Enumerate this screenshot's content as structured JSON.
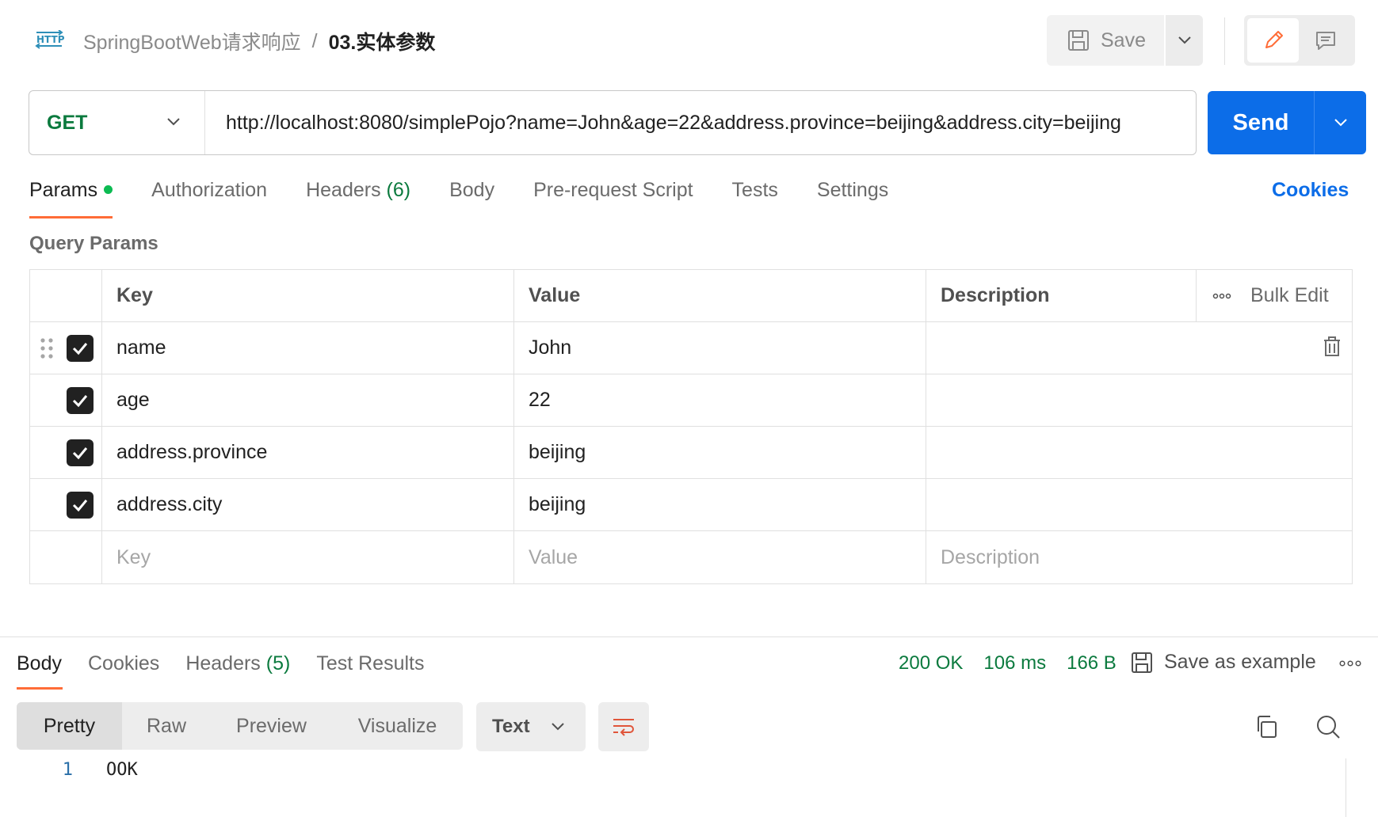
{
  "breadcrumb": {
    "collection": "SpringBootWeb请求响应",
    "separator": "/",
    "request": "03.实体参数"
  },
  "toolbar": {
    "save_label": "Save"
  },
  "request": {
    "method": "GET",
    "url": "http://localhost:8080/simplePojo?name=John&age=22&address.province=beijing&address.city=beijing",
    "send_label": "Send"
  },
  "tabs": {
    "params": "Params",
    "authorization": "Authorization",
    "headers": "Headers",
    "headers_count": "(6)",
    "body": "Body",
    "prerequest": "Pre-request Script",
    "tests": "Tests",
    "settings": "Settings",
    "cookies": "Cookies"
  },
  "query_params": {
    "title": "Query Params",
    "columns": {
      "key": "Key",
      "value": "Value",
      "description": "Description",
      "bulk_edit": "Bulk Edit"
    },
    "rows": [
      {
        "key": "name",
        "value": "John",
        "checked": true
      },
      {
        "key": "age",
        "value": "22",
        "checked": true
      },
      {
        "key": "address.province",
        "value": "beijing",
        "checked": true
      },
      {
        "key": "address.city",
        "value": "beijing",
        "checked": true
      }
    ],
    "placeholder": {
      "key": "Key",
      "value": "Value",
      "description": "Description"
    }
  },
  "response": {
    "tabs": {
      "body": "Body",
      "cookies": "Cookies",
      "headers": "Headers",
      "headers_count": "(5)",
      "test_results": "Test Results"
    },
    "status": "200 OK",
    "time": "106 ms",
    "size": "166 B",
    "save_example": "Save as example",
    "views": [
      "Pretty",
      "Raw",
      "Preview",
      "Visualize"
    ],
    "format": "Text",
    "lines": [
      {
        "no": "1",
        "text": "OOK"
      }
    ]
  },
  "colors": {
    "accent": "#ff6c37",
    "send": "#0c6de8",
    "success": "#0b7a3e",
    "method": "#0b7a3e"
  }
}
